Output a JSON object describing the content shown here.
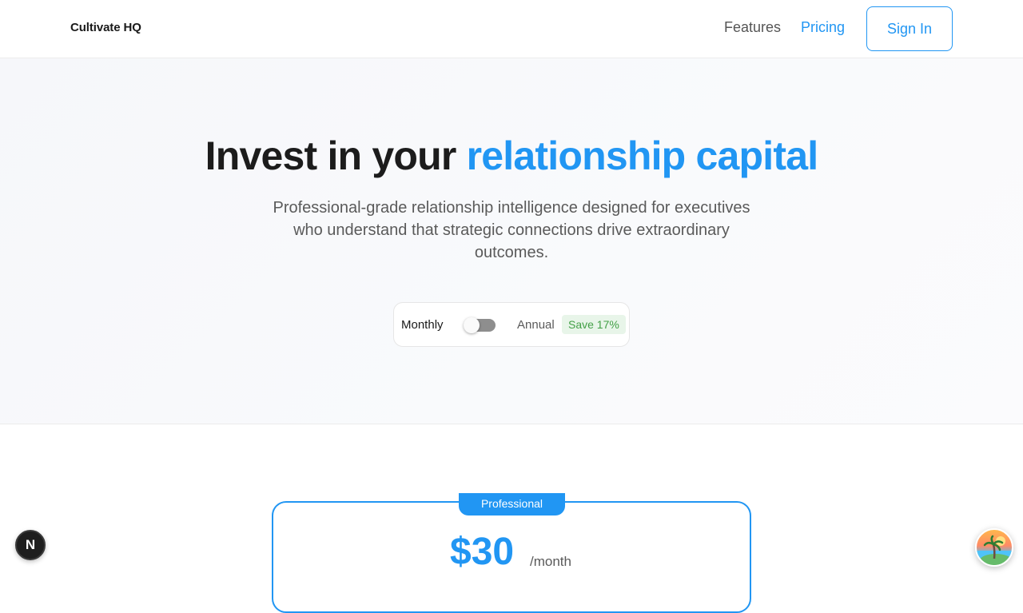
{
  "header": {
    "brand": "Cultivate HQ",
    "nav": {
      "features": "Features",
      "pricing": "Pricing",
      "sign_in": "Sign In"
    }
  },
  "hero": {
    "title_part1": "Invest in your ",
    "title_accent": "relationship capital",
    "subtitle": "Professional-grade relationship intelligence designed for executives who understand that strategic connections drive extraordinary outcomes.",
    "billing_toggle": {
      "monthly_label": "Monthly",
      "annual_label": "Annual",
      "save_badge": "Save 17%",
      "annual_selected": false
    }
  },
  "pricing_card": {
    "plan_label": "Professional",
    "price": "$30",
    "period": "/month"
  },
  "widgets": {
    "dev_indicator_glyph": "N"
  },
  "colors": {
    "accent": "#2196f3",
    "save_green": "#43a047",
    "save_bg": "#e8f5e9",
    "toggle_off": "#8e8e8e"
  }
}
